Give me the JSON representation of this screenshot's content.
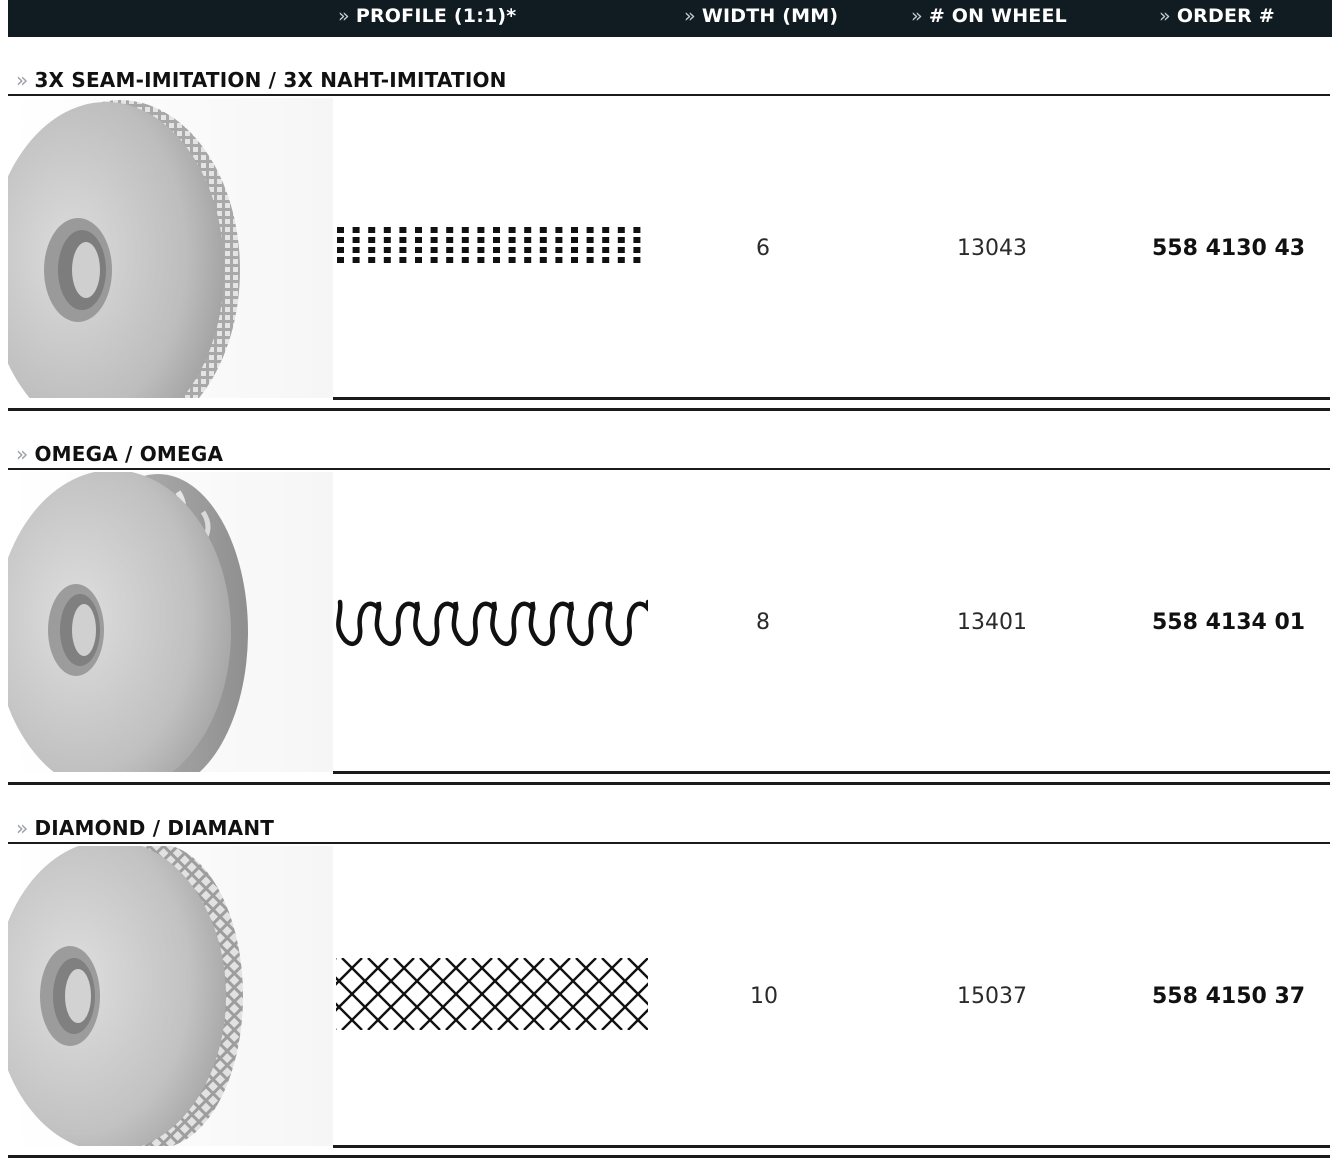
{
  "header": {
    "chevron": "»",
    "col_profile": "PROFILE (1:1)*",
    "col_width": "WIDTH (MM)",
    "col_on_wheel": "# ON WHEEL",
    "col_order": "ORDER #"
  },
  "sections": [
    {
      "chevron": "»",
      "title": "3X SEAM-IMITATION / 3X NAHT-IMITATION",
      "width_mm": "6",
      "on_wheel": "13043",
      "order": "558 4130 43",
      "wheel_image": "wheel-seam-imitation",
      "profile_pattern": "dots"
    },
    {
      "chevron": "»",
      "title": "OMEGA / OMEGA",
      "width_mm": "8",
      "on_wheel": "13401",
      "order": "558 4134 01",
      "wheel_image": "wheel-omega",
      "profile_pattern": "omega-wave"
    },
    {
      "chevron": "»",
      "title": "DIAMOND / DIAMANT",
      "width_mm": "10",
      "on_wheel": "15037",
      "order": "558 4150 37",
      "wheel_image": "wheel-diamond",
      "profile_pattern": "diamond-mesh"
    }
  ],
  "colors": {
    "header_bg": "#111c22",
    "rule": "#1b1b1b",
    "wheel_metal": "#c9c9c9"
  }
}
